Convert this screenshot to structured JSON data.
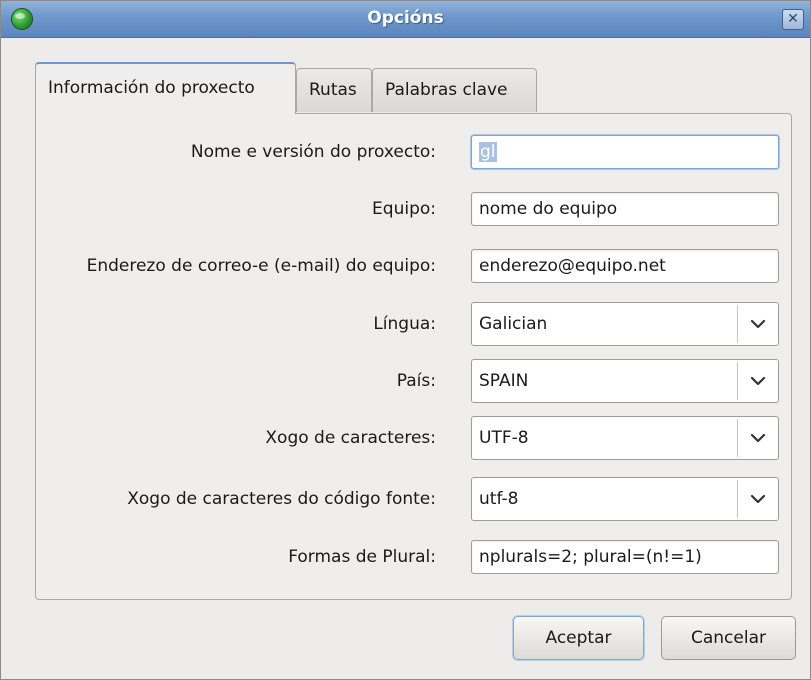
{
  "window": {
    "title": "Opcións",
    "close_glyph": "✕"
  },
  "tabs": [
    {
      "label": "Información do proxecto",
      "active": true
    },
    {
      "label": "Rutas",
      "active": false
    },
    {
      "label": "Palabras clave",
      "active": false
    }
  ],
  "form": {
    "project_name": {
      "label": "Nome e versión do proxecto:",
      "value": "gl"
    },
    "team": {
      "label": "Equipo:",
      "value": "nome do equipo"
    },
    "team_email": {
      "label": "Enderezo de correo-e (e-mail) do equipo:",
      "value": "enderezo@equipo.net"
    },
    "language": {
      "label": "Língua:",
      "value": "Galician"
    },
    "country": {
      "label": "País:",
      "value": "SPAIN"
    },
    "charset": {
      "label": "Xogo de caracteres:",
      "value": "UTF-8"
    },
    "source_charset": {
      "label": "Xogo de caracteres do código fonte:",
      "value": "utf-8"
    },
    "plural_forms": {
      "label": "Formas de Plural:",
      "value": "nplurals=2; plural=(n!=1)"
    }
  },
  "buttons": {
    "ok": "Aceptar",
    "cancel": "Cancelar"
  },
  "icons": {
    "app": "globe-icon",
    "close": "close-icon",
    "dropdown": "chevron-down-icon"
  },
  "colors": {
    "titlebar": "#6f97c9",
    "focus": "#7ea6d6",
    "selection": "#a8c2e3"
  }
}
